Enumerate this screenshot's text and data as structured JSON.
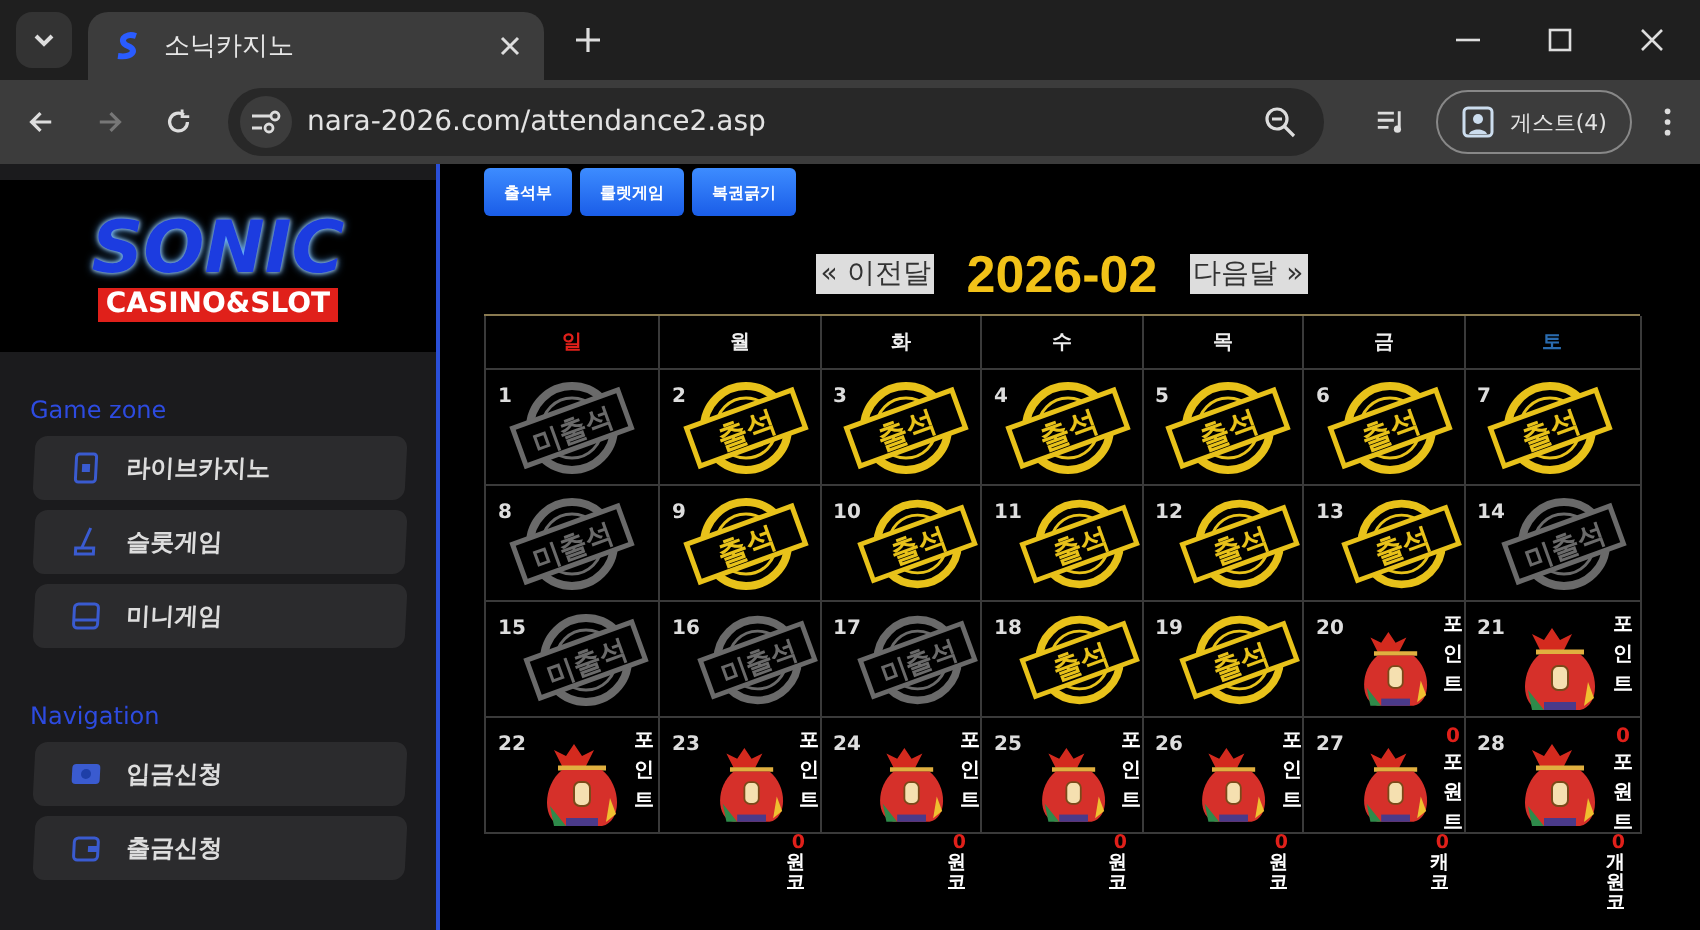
{
  "browser": {
    "tab_title": "소닉카지노",
    "url": "nara-2026.com/attendance2.asp",
    "profile": "게스트(4)"
  },
  "sidebar": {
    "logo_top": "SONIC",
    "logo_bottom": "CASINO&SLOT",
    "sections": [
      {
        "title": "Game zone",
        "items": [
          {
            "label": "라이브카지노"
          },
          {
            "label": "슬롯게임"
          },
          {
            "label": "미니게임"
          }
        ]
      },
      {
        "title": "Navigation",
        "items": [
          {
            "label": "입금신청"
          },
          {
            "label": "출금신청"
          }
        ]
      }
    ]
  },
  "buttons": [
    "출석부",
    "룰렛게임",
    "복권긁기"
  ],
  "calendar": {
    "prev": "« 이전달",
    "month": "2026-02",
    "next": "다음달 »",
    "weekdays": [
      {
        "label": "일",
        "kind": "sun"
      },
      {
        "label": "월",
        "kind": "day"
      },
      {
        "label": "화",
        "kind": "day"
      },
      {
        "label": "수",
        "kind": "day"
      },
      {
        "label": "목",
        "kind": "day"
      },
      {
        "label": "금",
        "kind": "day"
      },
      {
        "label": "토",
        "kind": "sat"
      }
    ],
    "days": [
      {
        "day": "1",
        "kind": "absent",
        "stamp": "미출석"
      },
      {
        "day": "2",
        "kind": "present",
        "stamp": "출석"
      },
      {
        "day": "3",
        "kind": "present",
        "stamp": "출석"
      },
      {
        "day": "4",
        "kind": "present",
        "stamp": "출석"
      },
      {
        "day": "5",
        "kind": "present",
        "stamp": "출석"
      },
      {
        "day": "6",
        "kind": "present",
        "stamp": "출석"
      },
      {
        "day": "7",
        "kind": "present",
        "stamp": "출석"
      },
      {
        "day": "8",
        "kind": "absent",
        "stamp": "미출석"
      },
      {
        "day": "9",
        "kind": "present",
        "stamp": "출석"
      },
      {
        "day": "10",
        "kind": "present",
        "stamp": "출석"
      },
      {
        "day": "11",
        "kind": "present",
        "stamp": "출석"
      },
      {
        "day": "12",
        "kind": "present",
        "stamp": "출석"
      },
      {
        "day": "13",
        "kind": "present",
        "stamp": "출석"
      },
      {
        "day": "14",
        "kind": "absent",
        "stamp": "미출석"
      },
      {
        "day": "15",
        "kind": "absent",
        "stamp": "미출석"
      },
      {
        "day": "16",
        "kind": "absent",
        "stamp": "미출석"
      },
      {
        "day": "17",
        "kind": "absent",
        "stamp": "미출석"
      },
      {
        "day": "18",
        "kind": "present",
        "stamp": "출석"
      },
      {
        "day": "19",
        "kind": "present",
        "stamp": "출석"
      },
      {
        "day": "20",
        "kind": "reward",
        "label": "포인트"
      },
      {
        "day": "21",
        "kind": "reward",
        "label": "포인트"
      },
      {
        "day": "22",
        "kind": "reward",
        "label": "포인트"
      },
      {
        "day": "23",
        "kind": "reward",
        "label": "포인트"
      },
      {
        "day": "24",
        "kind": "reward",
        "label": "포인트"
      },
      {
        "day": "25",
        "kind": "reward",
        "label": "포인트"
      },
      {
        "day": "26",
        "kind": "reward",
        "label": "포인트"
      },
      {
        "day": "27",
        "kind": "reward",
        "amount": "0",
        "label": "포원트"
      },
      {
        "day": "28",
        "kind": "reward",
        "amount": "0",
        "label": "포원트"
      }
    ],
    "overflow": [
      {
        "amount": "0",
        "text": "원코"
      },
      {
        "amount": "0",
        "text": "원코"
      },
      {
        "amount": "0",
        "text": "원코"
      },
      {
        "amount": "0",
        "text": "원코"
      },
      {
        "amount": "0",
        "text": "캐코"
      },
      {
        "amount": "0",
        "text": "개원코"
      }
    ]
  }
}
